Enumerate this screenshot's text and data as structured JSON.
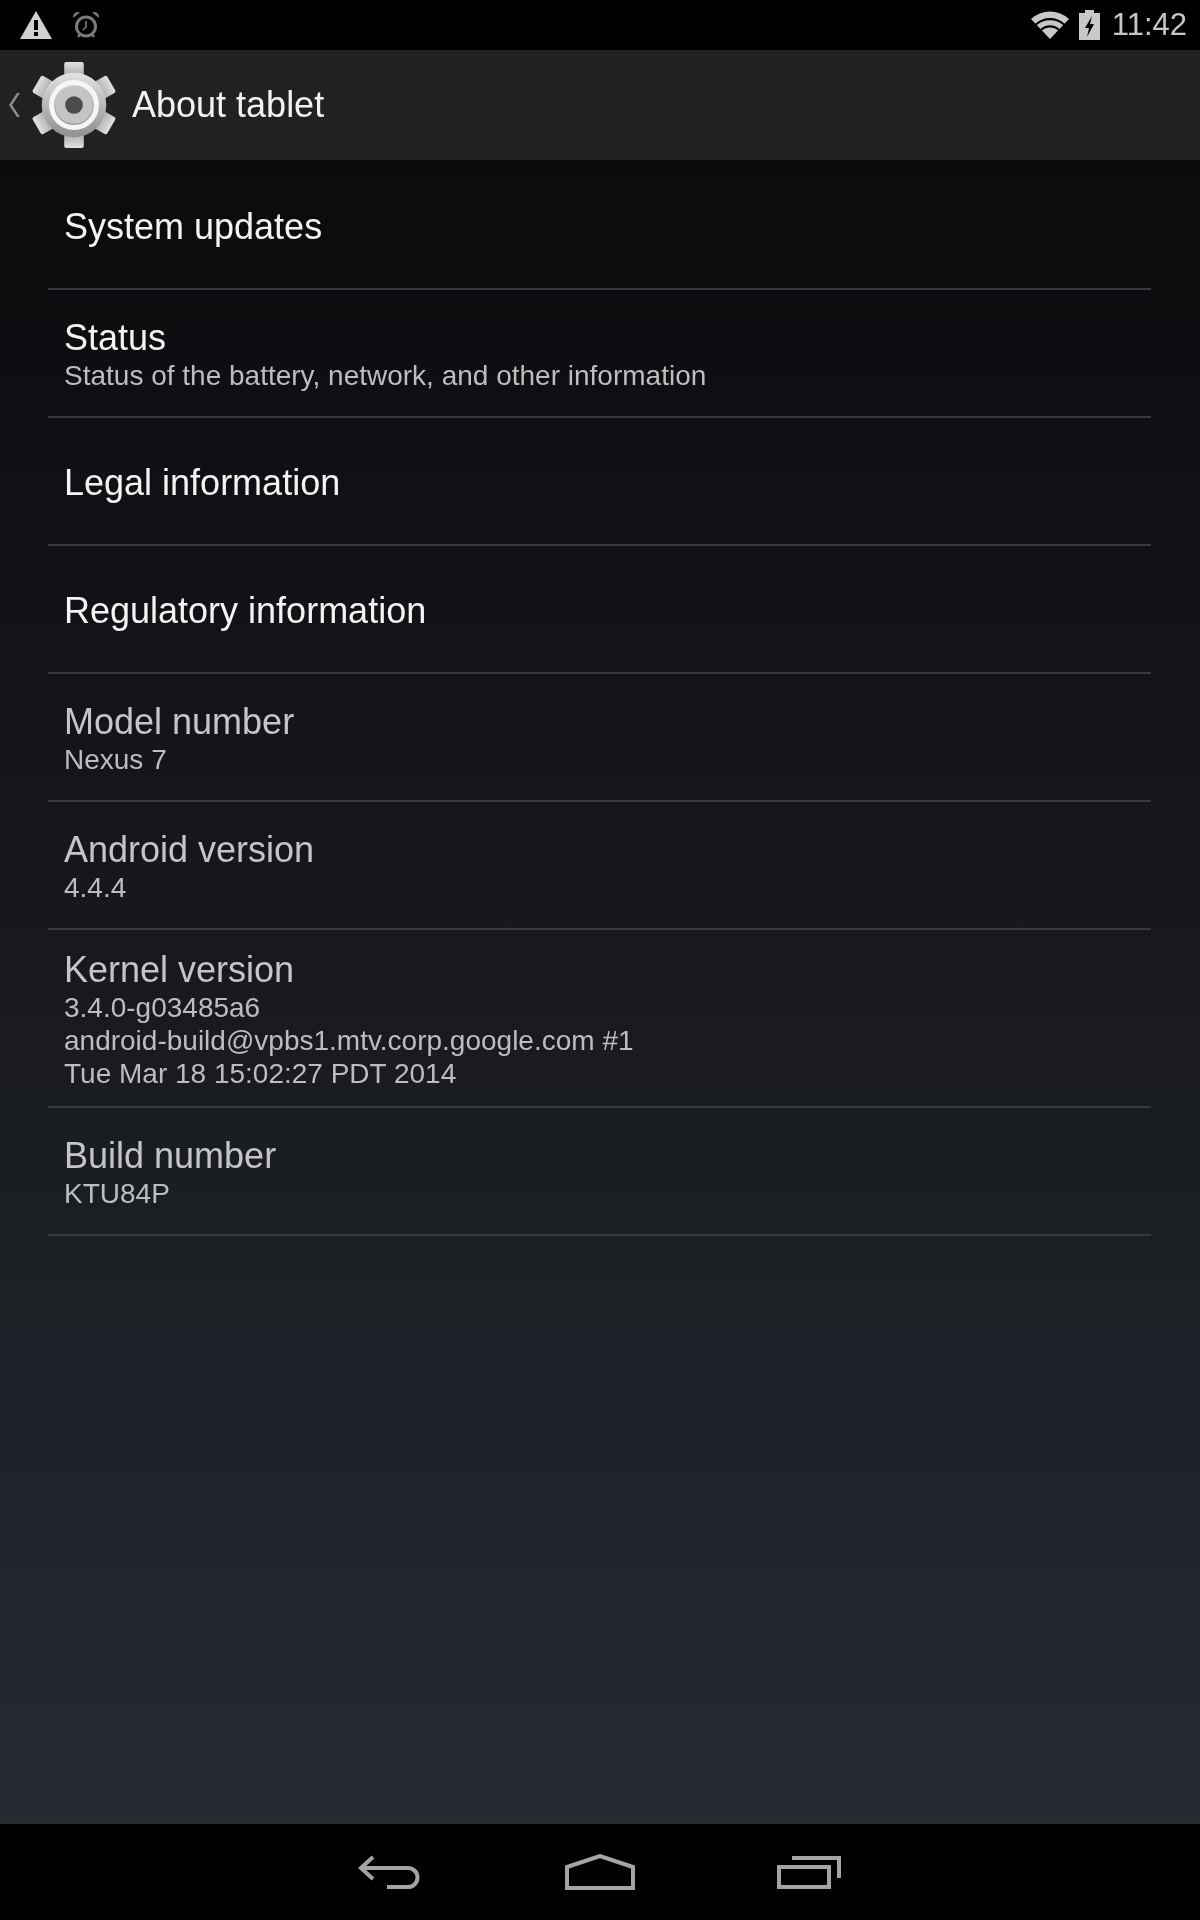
{
  "status_bar": {
    "time": "11:42"
  },
  "action_bar": {
    "title": "About tablet"
  },
  "preferences": [
    {
      "kind": "action",
      "title": "System updates"
    },
    {
      "kind": "action",
      "title": "Status",
      "summary": [
        "Status of the battery, network, and other information"
      ]
    },
    {
      "kind": "action",
      "title": "Legal information"
    },
    {
      "kind": "action",
      "title": "Regulatory information"
    },
    {
      "kind": "info",
      "title": "Model number",
      "summary": [
        "Nexus 7"
      ]
    },
    {
      "kind": "info",
      "title": "Android version",
      "summary": [
        "4.4.4"
      ]
    },
    {
      "kind": "info",
      "title": "Kernel version",
      "summary": [
        "3.4.0-g03485a6",
        "android-build@vpbs1.mtv.corp.google.com #1",
        "Tue Mar 18 15:02:27 PDT 2014"
      ]
    },
    {
      "kind": "info",
      "title": "Build number",
      "summary": [
        "KTU84P"
      ]
    }
  ]
}
